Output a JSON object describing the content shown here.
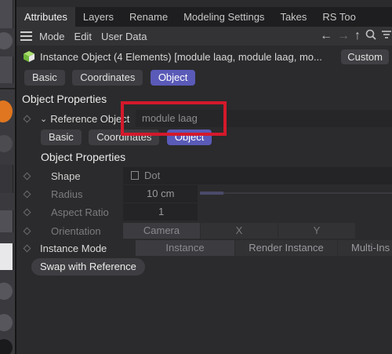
{
  "tabs": [
    "Attributes",
    "Layers",
    "Rename",
    "Modeling Settings",
    "Takes",
    "RS Too"
  ],
  "menu": [
    "Mode",
    "Edit",
    "User Data"
  ],
  "nav_icons": [
    "arrow-left-icon",
    "arrow-right-icon",
    "arrow-up-icon",
    "search-icon",
    "filter-icon"
  ],
  "object": {
    "title": "Instance Object (4 Elements) [module laag, module laag, mo...",
    "custom_label": "Custom"
  },
  "top_tabs": [
    "Basic",
    "Coordinates",
    "Object"
  ],
  "section_title": "Object Properties",
  "reference": {
    "label": "Reference Object",
    "value": "module laag"
  },
  "inner_tabs": [
    "Basic",
    "Coordinates",
    "Object"
  ],
  "inner_section_title": "Object Properties",
  "props": {
    "shape": {
      "label": "Shape",
      "value": "Dot"
    },
    "radius": {
      "label": "Radius",
      "value": "10 cm"
    },
    "aspect": {
      "label": "Aspect Ratio",
      "value": "1"
    },
    "orientation": {
      "label": "Orientation",
      "options": [
        "Camera",
        "X",
        "Y"
      ]
    }
  },
  "instance_mode": {
    "label": "Instance Mode",
    "options": [
      "Instance",
      "Render Instance",
      "Multi-Ins"
    ]
  },
  "swap_button": "Swap with Reference",
  "colors": {
    "accent": "#5a5ab8",
    "highlight": "#d4192b",
    "orange": "#e0761f"
  }
}
